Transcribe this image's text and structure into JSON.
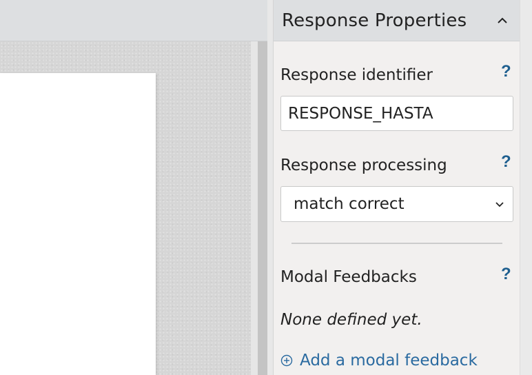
{
  "panel": {
    "title": "Response Properties",
    "collapse_icon": "chevron-up-icon"
  },
  "response_identifier": {
    "label": "Response identifier",
    "value": "RESPONSE_HASTA",
    "help": "?"
  },
  "response_processing": {
    "label": "Response processing",
    "selected": "match correct",
    "help": "?"
  },
  "modal_feedbacks": {
    "label": "Modal Feedbacks",
    "help": "?",
    "empty_text": "None defined yet.",
    "add_label": "Add a modal feedback",
    "add_icon": "plus-circle-icon"
  },
  "colors": {
    "accent": "#1f5f8f",
    "link": "#2a6aa0",
    "panel_bg": "#f2f0ef",
    "header_bg": "#dddfe1"
  }
}
